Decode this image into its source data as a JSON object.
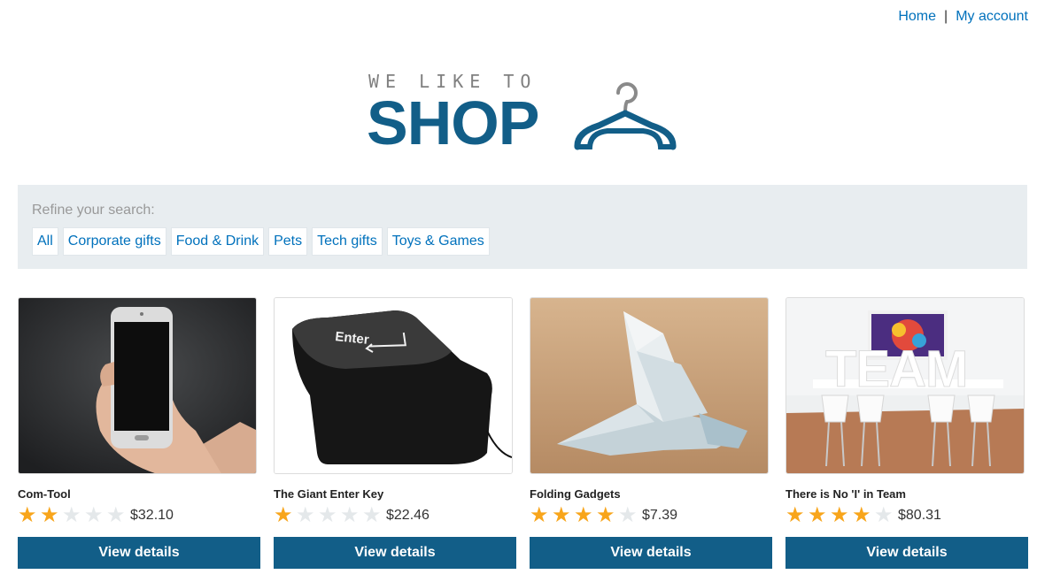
{
  "topnav": {
    "home": "Home",
    "separator": "|",
    "account": "My account"
  },
  "logo": {
    "tagline": "WE LIKE TO",
    "word": "SHOP",
    "icon": "hanger-icon"
  },
  "refine": {
    "label": "Refine your search:",
    "filters": [
      "All",
      "Corporate gifts",
      "Food & Drink",
      "Pets",
      "Tech gifts",
      "Toys & Games"
    ]
  },
  "products": [
    {
      "name": "Com-Tool",
      "rating": 2,
      "max_rating": 5,
      "price": "$32.10",
      "button": "View details",
      "image": "phone-in-hand-image"
    },
    {
      "name": "The Giant Enter Key",
      "rating": 1,
      "max_rating": 5,
      "price": "$22.46",
      "button": "View details",
      "image": "enter-key-image",
      "image_text": "Enter"
    },
    {
      "name": "Folding Gadgets",
      "rating": 4,
      "max_rating": 5,
      "price": "$7.39",
      "button": "View details",
      "image": "origami-bird-image"
    },
    {
      "name": "There is No 'I' in Team",
      "rating": 4,
      "max_rating": 5,
      "price": "$80.31",
      "button": "View details",
      "image": "team-letters-image",
      "image_text": "TEAM"
    }
  ],
  "colors": {
    "accent": "#125e88",
    "link": "#0071bc",
    "star_on": "#f8a51b",
    "star_off": "#e4e8ea",
    "refine_bg": "#e8edf0"
  }
}
